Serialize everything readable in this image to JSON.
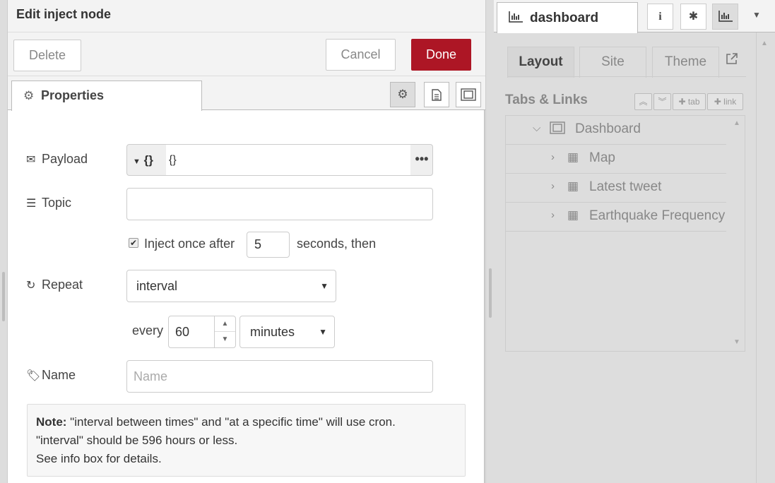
{
  "editor": {
    "title": "Edit inject node",
    "delete_label": "Delete",
    "cancel_label": "Cancel",
    "done_label": "Done",
    "properties_tab": "Properties",
    "payload_label": "Payload",
    "payload_type": "{}",
    "payload_value": "{}",
    "payload_expand": "•••",
    "topic_label": "Topic",
    "topic_value": "",
    "inject_once_checked": true,
    "inject_once_label": "Inject once after",
    "inject_once_seconds": "5",
    "inject_once_suffix": "seconds, then",
    "repeat_label": "Repeat",
    "repeat_value": "interval",
    "every_label": "every",
    "every_value": "60",
    "units_value": "minutes",
    "name_label": "Name",
    "name_placeholder": "Name",
    "note_bold": "Note:",
    "note_line1": " \"interval between times\" and \"at a specific time\" will use cron.",
    "note_line2": "\"interval\" should be 596 hours or less.",
    "note_line3": "See info box for details."
  },
  "sidebar": {
    "active_tab": "dashboard",
    "tabs": [
      "Layout",
      "Site",
      "Theme"
    ],
    "section_title": "Tabs & Links",
    "add_tab_label": "✚ tab",
    "add_link_label": "✚ link",
    "tree": {
      "root": "Dashboard",
      "groups": [
        "Map",
        "Latest tweet",
        "Earthquake Frequency"
      ]
    }
  },
  "colors": {
    "done_button": "#ad1625",
    "panel_bg": "#f3f3f3",
    "sidebar_bg": "#dddddd"
  }
}
